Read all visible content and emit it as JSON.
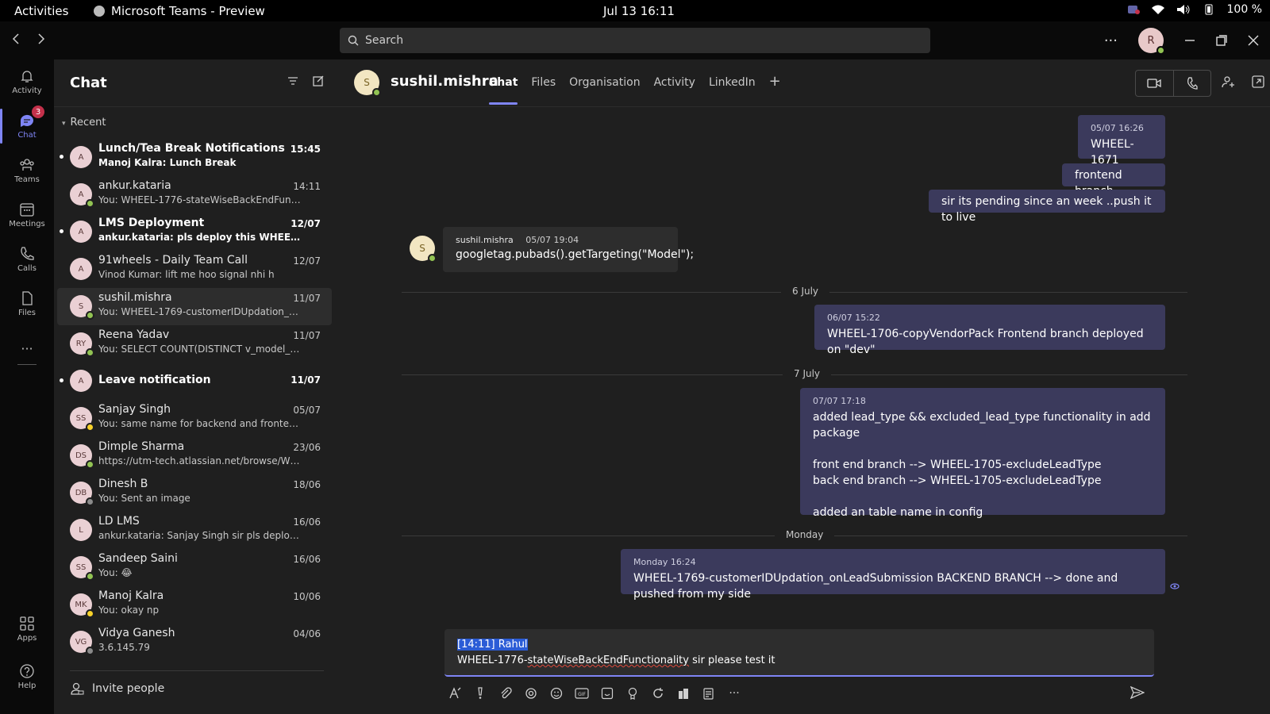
{
  "os": {
    "activities": "Activities",
    "app_name": "Microsoft Teams - Preview",
    "clock": "Jul 13  16:11",
    "battery": "100 %"
  },
  "titlebar": {
    "search_placeholder": "Search",
    "user_initial": "R"
  },
  "rail": {
    "items": [
      {
        "label": "Activity"
      },
      {
        "label": "Chat",
        "badge": "3"
      },
      {
        "label": "Teams"
      },
      {
        "label": "Meetings"
      },
      {
        "label": "Calls"
      },
      {
        "label": "Files"
      },
      {
        "label": "Apps"
      },
      {
        "label": "Help"
      }
    ]
  },
  "chatlist": {
    "title": "Chat",
    "recent_label": "Recent",
    "invite_label": "Invite people",
    "rows": [
      {
        "initials": "A",
        "name": "Lunch/Tea Break Notifications",
        "preview": "Manoj Kalra: Lunch Break",
        "time": "15:45",
        "unread": true
      },
      {
        "initials": "A",
        "name": "ankur.kataria",
        "preview": "You: WHEEL-1776-stateWiseBackEndFunction...",
        "time": "14:11",
        "unread": false,
        "status": "#92c353"
      },
      {
        "initials": "A",
        "name": "LMS Deployment",
        "preview": "ankur.kataria: pls deploy this WHEEL-1671 l...",
        "time": "12/07",
        "unread": true
      },
      {
        "initials": "A",
        "name": "91wheels - Daily Team Call",
        "preview": "Vinod Kumar: lift me hoo signal nhi h",
        "time": "12/07",
        "unread": false
      },
      {
        "initials": "S",
        "name": "sushil.mishra",
        "preview": "You: WHEEL-1769-customerIDUpdation_onLe...",
        "time": "11/07",
        "unread": false,
        "status": "#92c353",
        "selected": true
      },
      {
        "initials": "RY",
        "name": "Reena Yadav",
        "preview": "You: SELECT COUNT(DISTINCT v_model_displa...",
        "time": "11/07",
        "unread": false,
        "status": "#92c353"
      },
      {
        "initials": "A",
        "name": "Leave notification",
        "preview": "",
        "time": "11/07",
        "unread": true
      },
      {
        "initials": "SS",
        "name": "Sanjay Singh",
        "preview": "You: same name for backend and frontend bra...",
        "time": "05/07",
        "unread": false,
        "status": "#f8d22a"
      },
      {
        "initials": "DS",
        "name": "Dimple Sharma",
        "preview": "https://utm-tech.atlassian.net/browse/WHEEL...",
        "time": "23/06",
        "unread": false,
        "status": "#92c353"
      },
      {
        "initials": "DB",
        "name": "Dinesh B",
        "preview": "You: Sent an image",
        "time": "18/06",
        "unread": false,
        "status": "#8a8a8a"
      },
      {
        "initials": "L",
        "name": "LD LMS",
        "preview": "ankur.kataria: Sanjay Singh sir pls deploy WHE...",
        "time": "16/06",
        "unread": false
      },
      {
        "initials": "SS",
        "name": "Sandeep Saini",
        "preview": "You: 😂",
        "time": "16/06",
        "unread": false,
        "status": "#92c353"
      },
      {
        "initials": "MK",
        "name": "Manoj Kalra",
        "preview": "You: okay np",
        "time": "10/06",
        "unread": false,
        "status": "#f8d22a"
      },
      {
        "initials": "VG",
        "name": "Vidya Ganesh",
        "preview": "3.6.145.79",
        "time": "04/06",
        "unread": false,
        "status": "#8a8a8a"
      }
    ]
  },
  "conversation": {
    "person_initial": "S",
    "person_name": "sushil.mishra",
    "tabs": [
      "Chat",
      "Files",
      "Organisation",
      "Activity",
      "LinkedIn"
    ],
    "messages": {
      "m1_meta": "05/07 16:26",
      "m1_body": "WHEEL-1671",
      "m2_body": "frontend branch",
      "m3_body": "sir its pending since an week ..push it to live",
      "their_avatar": "S",
      "their_name": "sushil.mishra",
      "their_time": "05/07 19:04",
      "their_body": "googletag.pubads().getTargeting(\"Model\");",
      "div1": "6 July",
      "m4_meta": "06/07 15:22",
      "m4_body": "WHEEL-1706-copyVendorPack Frontend branch deployed on \"dev\"",
      "div2": "7 July",
      "m5_meta": "07/07 17:18",
      "m5_body": "added lead_type && excluded_lead_type functionality in add package\n\nfront end branch --> WHEEL-1705-excludeLeadType\nback end branch --> WHEEL-1705-excludeLeadType\n\nadded an table name in config",
      "div3": "Monday",
      "m6_meta": "Monday 16:24",
      "m6_body": "WHEEL-1769-customerIDUpdation_onLeadSubmission BACKEND BRANCH --> done and pushed from my side"
    },
    "compose": {
      "quote": "[14:11] Rahul",
      "line_prefix": "WHEEL-1776-",
      "line_misspelled": "stateWiseBackEndFunctionality",
      "line_suffix": " sir please test it"
    }
  },
  "colors": {
    "accent": "#7f85f5",
    "my_bubble": "#3b3a5c",
    "their_bubble": "#2d2d2d",
    "presence_available": "#92c353",
    "presence_away": "#f8d22a"
  }
}
